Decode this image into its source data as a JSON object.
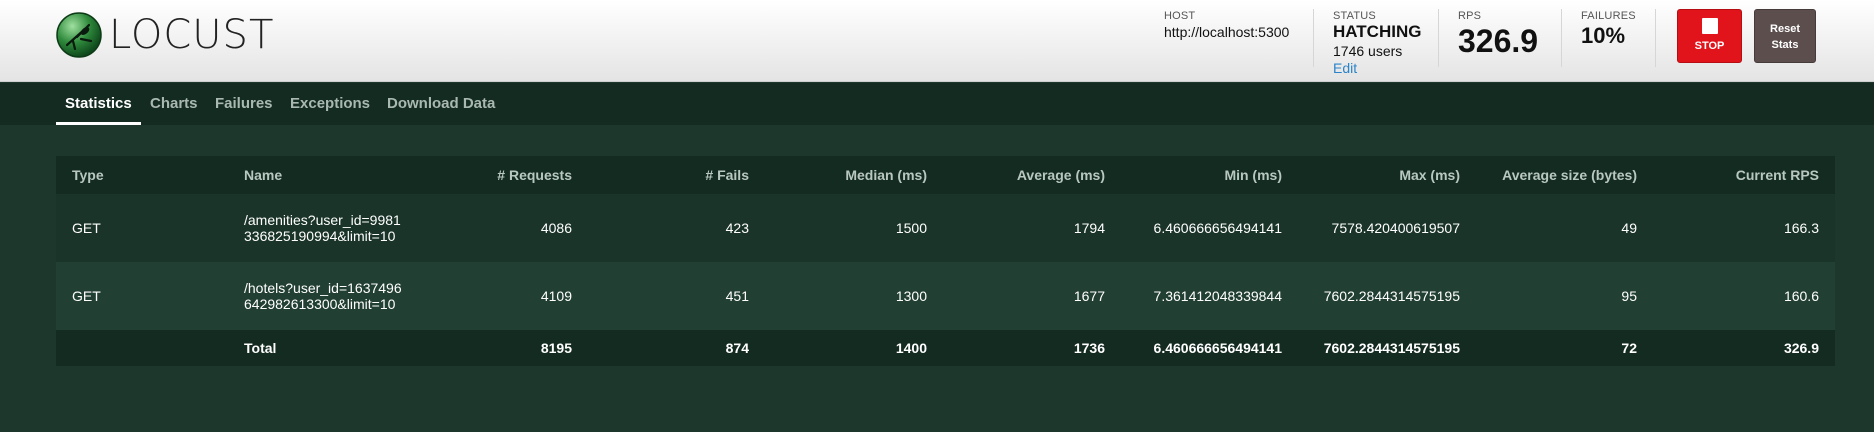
{
  "header": {
    "logo_text": "LOCUST",
    "host": {
      "label": "HOST",
      "value": "http://localhost:5300"
    },
    "status": {
      "label": "STATUS",
      "value": "HATCHING",
      "users": "1746 users",
      "edit": "Edit"
    },
    "rps": {
      "label": "RPS",
      "value": "326.9"
    },
    "failures": {
      "label": "FAILURES",
      "value": "10%"
    },
    "stop_label": "STOP",
    "reset_line1": "Reset",
    "reset_line2": "Stats"
  },
  "nav": {
    "tabs": [
      {
        "label": "Statistics",
        "active": true
      },
      {
        "label": "Charts"
      },
      {
        "label": "Failures"
      },
      {
        "label": "Exceptions"
      },
      {
        "label": "Download Data"
      }
    ]
  },
  "table": {
    "headers": [
      "Type",
      "Name",
      "# Requests",
      "# Fails",
      "Median (ms)",
      "Average (ms)",
      "Min (ms)",
      "Max (ms)",
      "Average size (bytes)",
      "Current RPS"
    ],
    "rows": [
      [
        "GET",
        "/amenities?user_id=9981336825190994&limit=10",
        "4086",
        "423",
        "1500",
        "1794",
        "6.460666656494141",
        "7578.420400619507",
        "49",
        "166.3"
      ],
      [
        "GET",
        "/hotels?user_id=1637496642982613300&limit=10",
        "4109",
        "451",
        "1300",
        "1677",
        "7.361412048339844",
        "7602.2844314575195",
        "95",
        "160.6"
      ]
    ],
    "total": [
      "",
      "Total",
      "8195",
      "874",
      "1400",
      "1736",
      "6.460666656494141",
      "7602.2844314575195",
      "72",
      "326.9"
    ]
  },
  "colors": {
    "background": "#1d372d",
    "nav": "#142b21",
    "stop": "#e1141b",
    "reset": "#5d4e4e",
    "link": "#2b84c9"
  }
}
